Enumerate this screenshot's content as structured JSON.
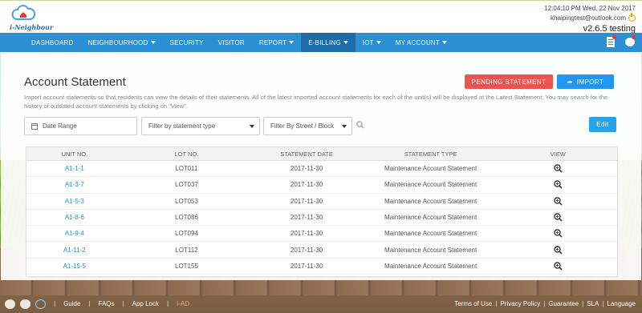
{
  "header": {
    "logo_text": "i-Neighbour",
    "datetime": "12:04:10 PM  Wed, 22 Nov 2017",
    "email": "khaipingtest@outlook.com",
    "version": "v2.6.5 testing"
  },
  "nav": {
    "items": [
      {
        "label": "DASHBOARD"
      },
      {
        "label": "NEIGHBOURHOOD"
      },
      {
        "label": "SECURITY"
      },
      {
        "label": "VISITOR"
      },
      {
        "label": "REPORT"
      },
      {
        "label": "E-BILLING"
      },
      {
        "label": "IOT"
      },
      {
        "label": "MY ACCOUNT"
      }
    ]
  },
  "page": {
    "title": "Account Statement",
    "pending_label": "PENDING STATEMENT",
    "import_label": "IMPORT",
    "description": "Import account statements so that residents can view the details of their statements. All of the latest imported account statements for each of the unit(s) will be displayed at the Latest Statement. You may search for the history of outdated account statements by clicking on \"View\".",
    "date_placeholder": "Date Range",
    "type_filter": "Filter by statement type",
    "street_filter": "Filter By Street / Block",
    "edit_label": "Edit"
  },
  "table": {
    "headers": [
      "UNIT NO.",
      "LOT NO.",
      "STATEMENT DATE",
      "STATEMENT TYPE",
      "VIEW"
    ],
    "rows": [
      {
        "unit": "A1-1-1",
        "lot": "LOT011",
        "date": "2017-11-30",
        "type": "Maintenance Account Statement"
      },
      {
        "unit": "A1-3-7",
        "lot": "LOT037",
        "date": "2017-11-30",
        "type": "Maintenance Account Statement"
      },
      {
        "unit": "A1-5-3",
        "lot": "LOT053",
        "date": "2017-11-30",
        "type": "Maintenance Account Statement"
      },
      {
        "unit": "A1-8-6",
        "lot": "LOT086",
        "date": "2017-11-30",
        "type": "Maintenance Account Statement"
      },
      {
        "unit": "A1-9-4",
        "lot": "LOT094",
        "date": "2017-11-30",
        "type": "Maintenance Account Statement"
      },
      {
        "unit": "A1-11-2",
        "lot": "LOT112",
        "date": "2017-11-30",
        "type": "Maintenance Account Statement"
      },
      {
        "unit": "A1-15-5",
        "lot": "LOT155",
        "date": "2017-11-30",
        "type": "Maintenance Account Statement"
      }
    ]
  },
  "footer": {
    "left_links": [
      "Guide",
      "FAQs",
      "App Lock",
      "I-AD"
    ],
    "right_links": [
      "Terms of Use",
      "Privacy Policy",
      "Guarantee",
      "SLA",
      "Language"
    ]
  },
  "colors": {
    "nav_bg": "#2a8fd3",
    "nav_active": "#1c6da8",
    "pending": "#ef5350",
    "import": "#2196f3"
  }
}
